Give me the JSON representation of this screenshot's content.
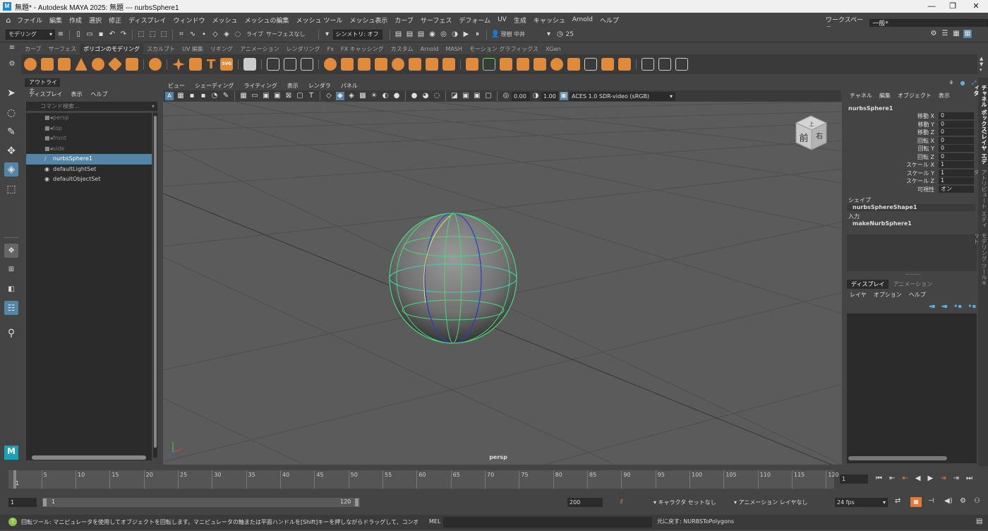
{
  "window": {
    "title": "無題* - Autodesk MAYA 2025: 無題   ---   nurbsSphere1",
    "icon_letter": "M",
    "minimize": "—",
    "maximize": "❐",
    "close": "✕"
  },
  "menu": {
    "items": [
      "ファイル",
      "編集",
      "作成",
      "選択",
      "修正",
      "ディスプレイ",
      "ウィンドウ",
      "メッシュ",
      "メッシュの編集",
      "メッシュ ツール",
      "メッシュ表示",
      "カーブ",
      "サーフェス",
      "デフォーム",
      "UV",
      "生成",
      "キャッシュ",
      "Arnold",
      "ヘルプ"
    ],
    "workspace_label": "ワークスペース:",
    "workspace_value": "一般*"
  },
  "status_line": {
    "mode": "モデリング",
    "live_label": "ライブ",
    "live_value": "サーフェスなし",
    "symmetry": "シンメトリ: オフ",
    "user": "理樹 中井",
    "time_count": "25"
  },
  "shelf": {
    "tabs": [
      "カーブ",
      "サーフェス",
      "ポリゴンのモデリング",
      "スカルプト",
      "UV 編集",
      "リギング",
      "アニメーション",
      "レンダリング",
      "Fx",
      "FX キャッシング",
      "カスタム",
      "Arnold",
      "MASH",
      "モーション グラフィックス",
      "XGen"
    ],
    "active_tab": "ポリゴンのモデリング",
    "svg_label": "SVG",
    "text_label": "T"
  },
  "outliner": {
    "tab": "アウトライナ",
    "menu": [
      "ディスプレイ",
      "表示",
      "ヘルプ"
    ],
    "search_placeholder": "コマンド検索...",
    "items": [
      {
        "label": "persp",
        "state": "dim"
      },
      {
        "label": "top",
        "state": "dim"
      },
      {
        "label": "front",
        "state": "dim"
      },
      {
        "label": "side",
        "state": "dim"
      },
      {
        "label": "nurbsSphere1",
        "state": "sel"
      },
      {
        "label": "defaultLightSet",
        "state": "normal"
      },
      {
        "label": "defaultObjectSet",
        "state": "normal"
      }
    ]
  },
  "viewport": {
    "menu": [
      "ビュー",
      "シェーディング",
      "ライティング",
      "表示",
      "レンダラ",
      "パネル"
    ],
    "exposure": "0.00",
    "gamma": "1.00",
    "colorspace": "ACES 1.0 SDR-video (sRGB)",
    "camera_label": "persp",
    "cube_front": "前",
    "cube_right": "右",
    "cube_top": "上"
  },
  "channel_box": {
    "menu": [
      "チャネル",
      "編集",
      "オブジェクト",
      "表示"
    ],
    "object": "nurbsSphere1",
    "channels": [
      {
        "name": "移動 X",
        "value": "0"
      },
      {
        "name": "移動 Y",
        "value": "0"
      },
      {
        "name": "移動 Z",
        "value": "0"
      },
      {
        "name": "回転 X",
        "value": "0"
      },
      {
        "name": "回転 Y",
        "value": "0"
      },
      {
        "name": "回転 Z",
        "value": "0"
      },
      {
        "name": "スケール X",
        "value": "1"
      },
      {
        "name": "スケール Y",
        "value": "1"
      },
      {
        "name": "スケール Z",
        "value": "1"
      },
      {
        "name": "可視性",
        "value": "オン"
      }
    ],
    "shapes_label": "シェイプ",
    "shape_name": "nurbsSphereShape1",
    "inputs_label": "入力",
    "input_name": "makeNurbSphere1"
  },
  "layer_editor": {
    "tabs": [
      "ディスプレイ",
      "アニメーション"
    ],
    "menu": [
      "レイヤ",
      "オプション",
      "ヘルプ"
    ]
  },
  "side_tabs": [
    "チャネル ボックス/レイヤ エディタ",
    "アトリビュート エディタ",
    "モデリング ツールキット"
  ],
  "timeline": {
    "ticks": [
      "5",
      "10",
      "15",
      "20",
      "25",
      "30",
      "35",
      "40",
      "45",
      "50",
      "55",
      "60",
      "65",
      "70",
      "75",
      "80",
      "85",
      "90",
      "95",
      "100",
      "105",
      "110",
      "115",
      "120"
    ],
    "start_label": "1",
    "current_frame": "1"
  },
  "range": {
    "start": "1",
    "inner_start": "1",
    "inner_end": "120",
    "end": "200",
    "character_set": "キャラクタ セットなし",
    "anim_layer": "アニメーション レイヤなし",
    "fps": "24 fps"
  },
  "command_line": {
    "help": "回転ツール: マニピュレータを使用してオブジェクトを回転します。マニピュレータの軸または平面ハンドルを[Shift]キーを押しながらドラッグして、コンポーネントまたはオブジェクトのクローンを作成し",
    "lang": "MEL",
    "result": "元に戻す: NURBSToPolygons"
  }
}
